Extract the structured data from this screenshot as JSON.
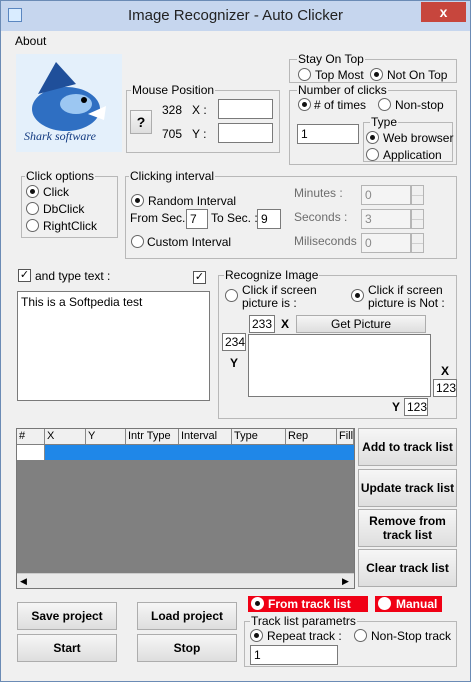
{
  "window": {
    "title": "Image Recognizer - Auto Clicker",
    "close_label": "x"
  },
  "menu": {
    "about": "About"
  },
  "mouse_position": {
    "title": "Mouse Position",
    "pick_label": "?",
    "x_value": "328",
    "x_label": "X :",
    "y_value": "705",
    "y_label": "Y :"
  },
  "stay_on_top": {
    "title": "Stay On Top",
    "top_most": "Top Most",
    "not_on_top": "Not On Top"
  },
  "number_of_clicks": {
    "title": "Number of clicks",
    "num_times": "# of times",
    "non_stop": "Non-stop",
    "count_value": "1",
    "type_title": "Type",
    "web_browser": "Web browser",
    "application": "Application"
  },
  "click_options": {
    "title": "Click options",
    "click": "Click",
    "dbclick": "DbClick",
    "rightclick": "RightClick"
  },
  "clicking_interval": {
    "title": "Clicking interval",
    "random": "Random Interval",
    "from_label": "From Sec. :",
    "from_value": "7",
    "to_label": "To Sec. :",
    "to_value": "9",
    "custom": "Custom Interval",
    "minutes_label": "Minutes :",
    "minutes_value": "0",
    "seconds_label": "Seconds :",
    "seconds_value": "3",
    "ms_label": "Miliseconds :",
    "ms_value": "0"
  },
  "type_text": {
    "label": "and type text :",
    "value": "This is a Softpedia test"
  },
  "recognize": {
    "title": "Recognize Image",
    "click_if_is": "Click if screen picture is :",
    "click_if_not": "Click if screen picture is Not :",
    "x_value": "233",
    "x_label": "X",
    "get_picture": "Get Picture",
    "y_value": "234",
    "y_label": "Y",
    "x2_label": "X",
    "x2_value": "123",
    "y2_label": "Y",
    "y2_value": "123"
  },
  "grid": {
    "columns": [
      "#",
      "X",
      "Y",
      "Intr Type",
      "Interval",
      "Type",
      "Rep",
      "Fill"
    ]
  },
  "buttons": {
    "add": "Add to track list",
    "update": "Update track list",
    "remove": "Remove from track list",
    "clear": "Clear track list",
    "save": "Save project",
    "load": "Load project",
    "start": "Start",
    "stop": "Stop"
  },
  "mode": {
    "from_track": "From track list",
    "manual": "Manual"
  },
  "track_params": {
    "title": "Track list parametrs",
    "repeat": "Repeat track :",
    "non_stop": "Non-Stop track",
    "repeat_value": "1"
  },
  "colors": {
    "accent_red": "#f00015",
    "selection_blue": "#1f87e8",
    "grid_gray": "#808080"
  }
}
